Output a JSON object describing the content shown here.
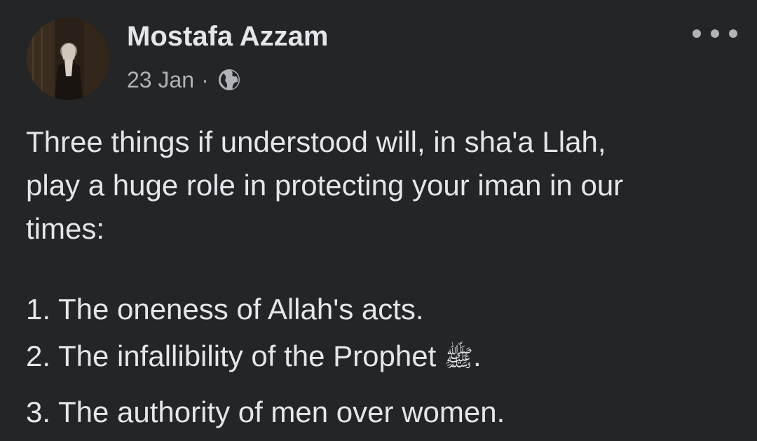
{
  "post": {
    "author": "Mostafa Azzam",
    "date": "23 Jan",
    "separator": "·",
    "privacy_icon": "globe-icon",
    "menu_icon": "more-options-icon",
    "text_lines": [
      "Three things if understood will, in sha'a Llah,",
      "play a huge role in protecting your iman in our",
      "times:"
    ],
    "list": [
      "1. The oneness of Allah's acts.",
      "2. The infallibility of the Prophet ",
      "3. The authority of men over women."
    ],
    "salawat_glyph": "ﷺ",
    "list_item_2_end": "."
  },
  "colors": {
    "background": "#242526",
    "primary_text": "#e4e6eb",
    "secondary_text": "#b0b3b8"
  }
}
